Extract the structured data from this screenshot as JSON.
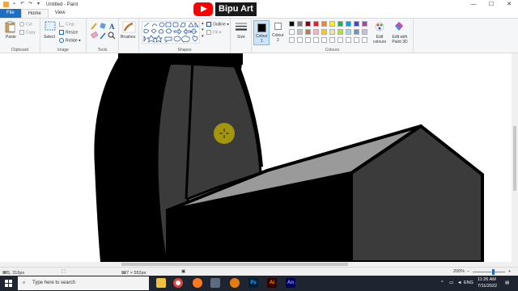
{
  "window": {
    "title": "Untitled - Paint",
    "min_glyph": "—",
    "max_glyph": "☐",
    "close_glyph": "✕"
  },
  "overlay": {
    "channel": "Bipu Art"
  },
  "tabs": [
    "File",
    "Home",
    "View"
  ],
  "ribbon": {
    "clipboard": {
      "paste": "Paste",
      "cut": "Cut",
      "copy": "Copy",
      "label": "Clipboard"
    },
    "image": {
      "select": "Select",
      "crop": "Crop",
      "resize": "Resize",
      "rotate": "Rotate",
      "label": "Image"
    },
    "tools": {
      "label": "Tools"
    },
    "brushes": {
      "label": "Brushes"
    },
    "shapes": {
      "outline": "Outline",
      "fill": "Fill",
      "label": "Shapes"
    },
    "size": {
      "label": "Size"
    },
    "colours": {
      "colour1": "Colour\n1",
      "colour2": "Colour\n2",
      "edit": "Edit colours",
      "paint3d": "Edit with Paint 3D",
      "label": "Colours",
      "palette_row1": [
        "#000000",
        "#7f7f7f",
        "#880015",
        "#ed1c24",
        "#ff7f27",
        "#fff200",
        "#22b14c",
        "#00a2e8",
        "#3f48cc",
        "#a349a4"
      ],
      "palette_row2": [
        "#ffffff",
        "#c3c3c3",
        "#b97a57",
        "#ffaec9",
        "#ffc90e",
        "#efe4b0",
        "#b5e61d",
        "#99d9ea",
        "#7092be",
        "#c8bfe7"
      ],
      "palette_row3": [
        "#ffffff",
        "#ffffff",
        "#ffffff",
        "#ffffff",
        "#ffffff",
        "#ffffff",
        "#ffffff",
        "#ffffff",
        "#ffffff",
        "#ffffff"
      ],
      "active_colour1": "#000000",
      "active_colour2": "#ffffff"
    }
  },
  "status": {
    "position": "285, 316px",
    "canvas_size": "987 × 552px",
    "zoom": "200%"
  },
  "taskbar": {
    "search_placeholder": "Type here to search",
    "lang": "ENG",
    "time": "11:26 AM",
    "date": "7/11/2022"
  }
}
